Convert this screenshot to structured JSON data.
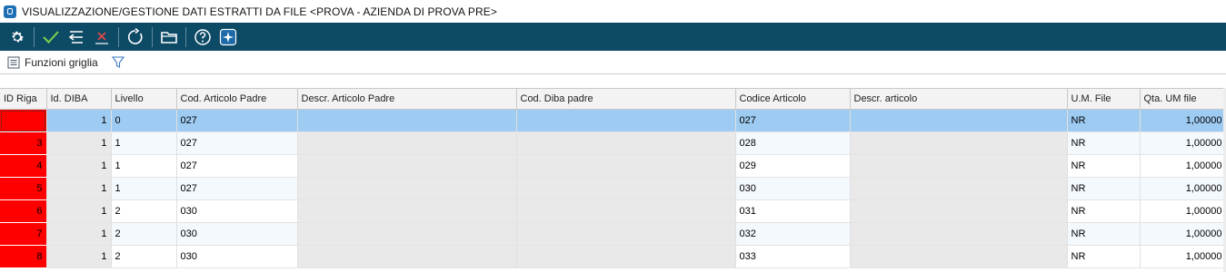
{
  "window": {
    "title": "VISUALIZZAZIONE/GESTIONE DATI ESTRATTI DA FILE <PROVA - AZIENDA DI PROVA PRE>"
  },
  "toolbar": {
    "icons": [
      "gear-icon",
      "check-icon",
      "undo-list-icon",
      "close-icon",
      "refresh-icon",
      "folder-icon",
      "help-icon",
      "sparkle-icon"
    ],
    "colors": {
      "background": "#0d4a66",
      "check": "#7fd34d",
      "close": "#e04848"
    }
  },
  "subbar": {
    "grid_functions_label": "Funzioni griglia"
  },
  "grid": {
    "columns": [
      "ID Riga",
      "Id. DIBA",
      "Livello",
      "Cod. Articolo Padre",
      "Descr. Articolo Padre",
      "Cod. Diba padre",
      "Codice Articolo",
      "Descr. articolo",
      "U.M. File",
      "Qta. UM file"
    ],
    "rows": [
      {
        "id_riga": "",
        "id_diba": "1",
        "livello": "0",
        "cod_padre": "027",
        "descr_padre": "",
        "cod_diba_padre": "",
        "codice": "027",
        "descr": "",
        "um": "NR",
        "qta": "1,00000"
      },
      {
        "id_riga": "3",
        "id_diba": "1",
        "livello": "1",
        "cod_padre": "027",
        "descr_padre": "",
        "cod_diba_padre": "",
        "codice": "028",
        "descr": "",
        "um": "NR",
        "qta": "1,00000"
      },
      {
        "id_riga": "4",
        "id_diba": "1",
        "livello": "1",
        "cod_padre": "027",
        "descr_padre": "",
        "cod_diba_padre": "",
        "codice": "029",
        "descr": "",
        "um": "NR",
        "qta": "1,00000"
      },
      {
        "id_riga": "5",
        "id_diba": "1",
        "livello": "1",
        "cod_padre": "027",
        "descr_padre": "",
        "cod_diba_padre": "",
        "codice": "030",
        "descr": "",
        "um": "NR",
        "qta": "1,00000"
      },
      {
        "id_riga": "6",
        "id_diba": "1",
        "livello": "2",
        "cod_padre": "030",
        "descr_padre": "",
        "cod_diba_padre": "",
        "codice": "031",
        "descr": "",
        "um": "NR",
        "qta": "1,00000"
      },
      {
        "id_riga": "7",
        "id_diba": "1",
        "livello": "2",
        "cod_padre": "030",
        "descr_padre": "",
        "cod_diba_padre": "",
        "codice": "032",
        "descr": "",
        "um": "NR",
        "qta": "1,00000"
      },
      {
        "id_riga": "8",
        "id_diba": "1",
        "livello": "2",
        "cod_padre": "030",
        "descr_padre": "",
        "cod_diba_padre": "",
        "codice": "033",
        "descr": "",
        "um": "NR",
        "qta": "1,00000"
      }
    ],
    "colors": {
      "id_highlight": "#ff0000",
      "selected_row": "#9ecbf2"
    }
  }
}
